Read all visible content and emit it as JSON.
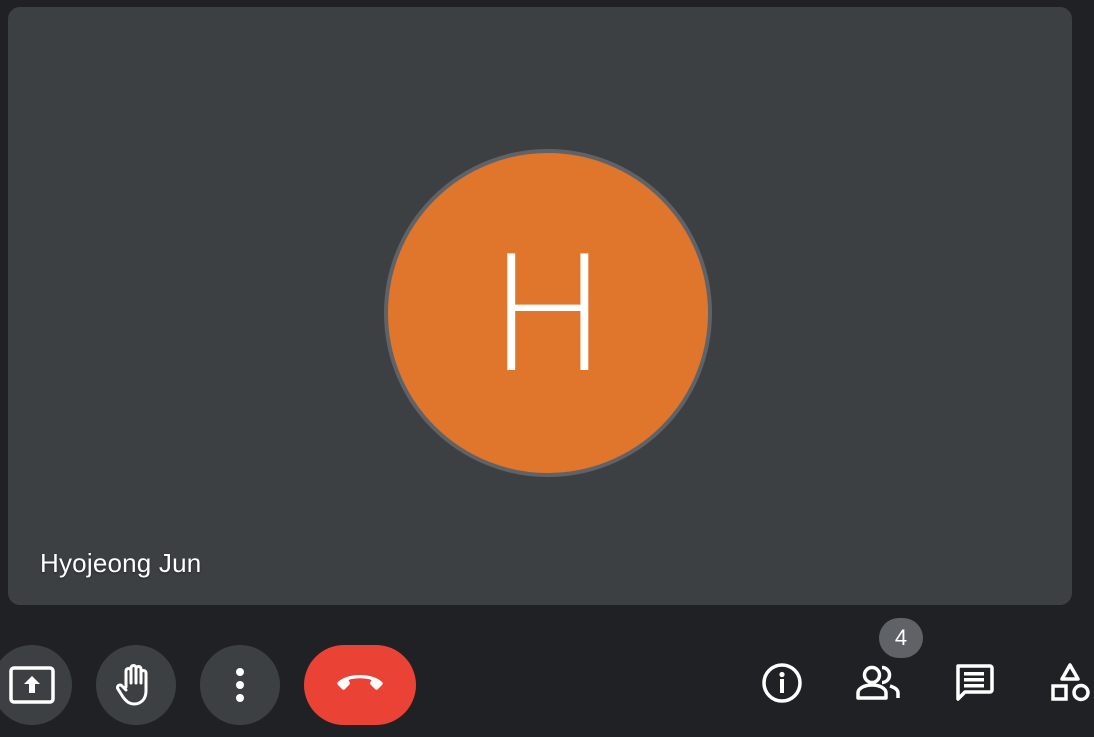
{
  "participant": {
    "name": "Hyojeong Jun",
    "initial": "H",
    "avatar_color": "#e0752c"
  },
  "controls": {
    "present": {
      "icon": "present-screen-icon"
    },
    "raise_hand": {
      "icon": "hand-icon"
    },
    "more": {
      "icon": "more-vert-icon"
    },
    "leave": {
      "icon": "call-end-icon",
      "color": "#ea4335"
    }
  },
  "side_controls": {
    "info": {
      "icon": "info-icon"
    },
    "people": {
      "icon": "people-icon",
      "count": "4"
    },
    "chat": {
      "icon": "chat-icon"
    },
    "activities": {
      "icon": "activities-icon"
    }
  },
  "colors": {
    "background": "#202124",
    "tile": "#3c4043",
    "button": "#3c4043",
    "badge": "#5f6368"
  }
}
